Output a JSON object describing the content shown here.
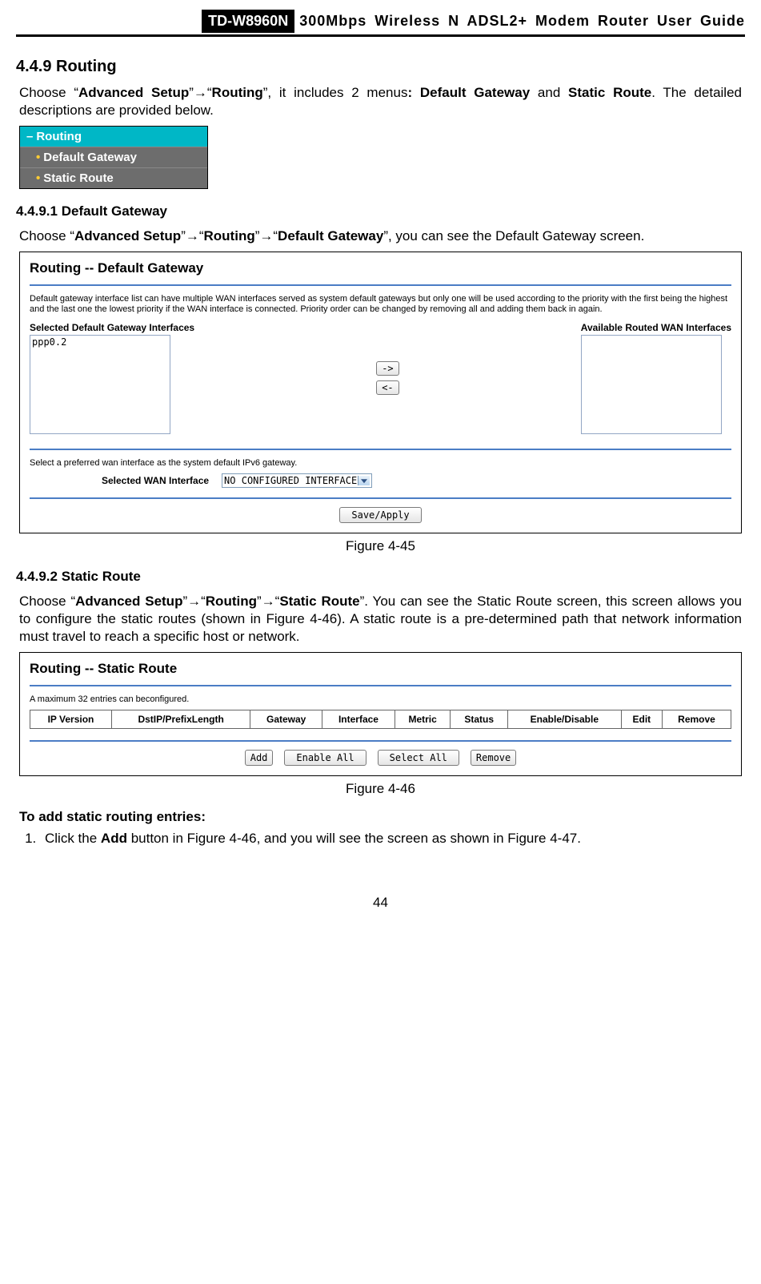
{
  "header": {
    "model": "TD-W8960N",
    "title": "300Mbps Wireless N ADSL2+ Modem Router User Guide"
  },
  "section449": {
    "number_title": "4.4.9    Routing",
    "intro_pre": "Choose “",
    "bc1": "Advanced Setup",
    "arrow": "”→“",
    "bc2": "Routing",
    "intro_mid": "”, it includes 2 menus",
    "menus_bold": ": Default Gateway",
    "and": " and ",
    "menus_bold2": "Static Route",
    "intro_tail": ". The detailed descriptions are provided below."
  },
  "nav": {
    "head": "Routing",
    "item1": "Default Gateway",
    "item2": "Static Route"
  },
  "section4491": {
    "number_title": "4.4.9.1    Default Gateway",
    "intro_pre": "Choose “",
    "bc1": "Advanced Setup",
    "arrow1": "”→“",
    "bc2": "Routing",
    "arrow2": "”→“",
    "bc3": "Default Gateway",
    "intro_tail": "”, you can see the Default Gateway screen."
  },
  "defaultGateway": {
    "heading": "Routing -- Default Gateway",
    "desc": "Default gateway interface list can have multiple WAN interfaces served as system default gateways but only one will be used according to the priority with the first being the highest and the last one the lowest priority if the WAN interface is connected. Priority order can be changed by removing all and adding them back in again.",
    "selected_label": "Selected Default Gateway Interfaces",
    "available_label": "Available Routed WAN Interfaces",
    "selected_items": [
      "ppp0.2"
    ],
    "arrow_right": "->",
    "arrow_left": "<-",
    "ipv6_desc": "Select a preferred wan interface as the system default IPv6 gateway.",
    "wan_label": "Selected WAN Interface",
    "wan_value": "NO CONFIGURED INTERFACE",
    "save": "Save/Apply"
  },
  "fig45": "Figure 4-45",
  "section4492": {
    "number_title": "4.4.9.2    Static Route",
    "intro_pre": "Choose “",
    "bc1": "Advanced Setup",
    "arrow1": "”→“",
    "bc2": "Routing",
    "arrow2": "”→“",
    "bc3": "Static Route",
    "intro_tail": "”. You can see the Static Route screen, this screen allows you to configure the static routes (shown in Figure 4-46). A static route is a pre-determined path that network information must travel to reach a specific host or network."
  },
  "staticRoute": {
    "heading": "Routing -- Static Route",
    "max": "A maximum 32 entries can beconfigured.",
    "cols": [
      "IP Version",
      "DstIP/PrefixLength",
      "Gateway",
      "Interface",
      "Metric",
      "Status",
      "Enable/Disable",
      "Edit",
      "Remove"
    ],
    "btn_add": "Add",
    "btn_enable": "Enable All",
    "btn_select": "Select All",
    "btn_remove": "Remove"
  },
  "fig46": "Figure 4-46",
  "addEntries": {
    "title": "To add static routing entries:",
    "step1_pre": "Click the ",
    "step1_bold": "Add",
    "step1_post": " button in Figure 4-46, and you will see the screen as shown in Figure 4-47."
  },
  "pageNumber": "44"
}
